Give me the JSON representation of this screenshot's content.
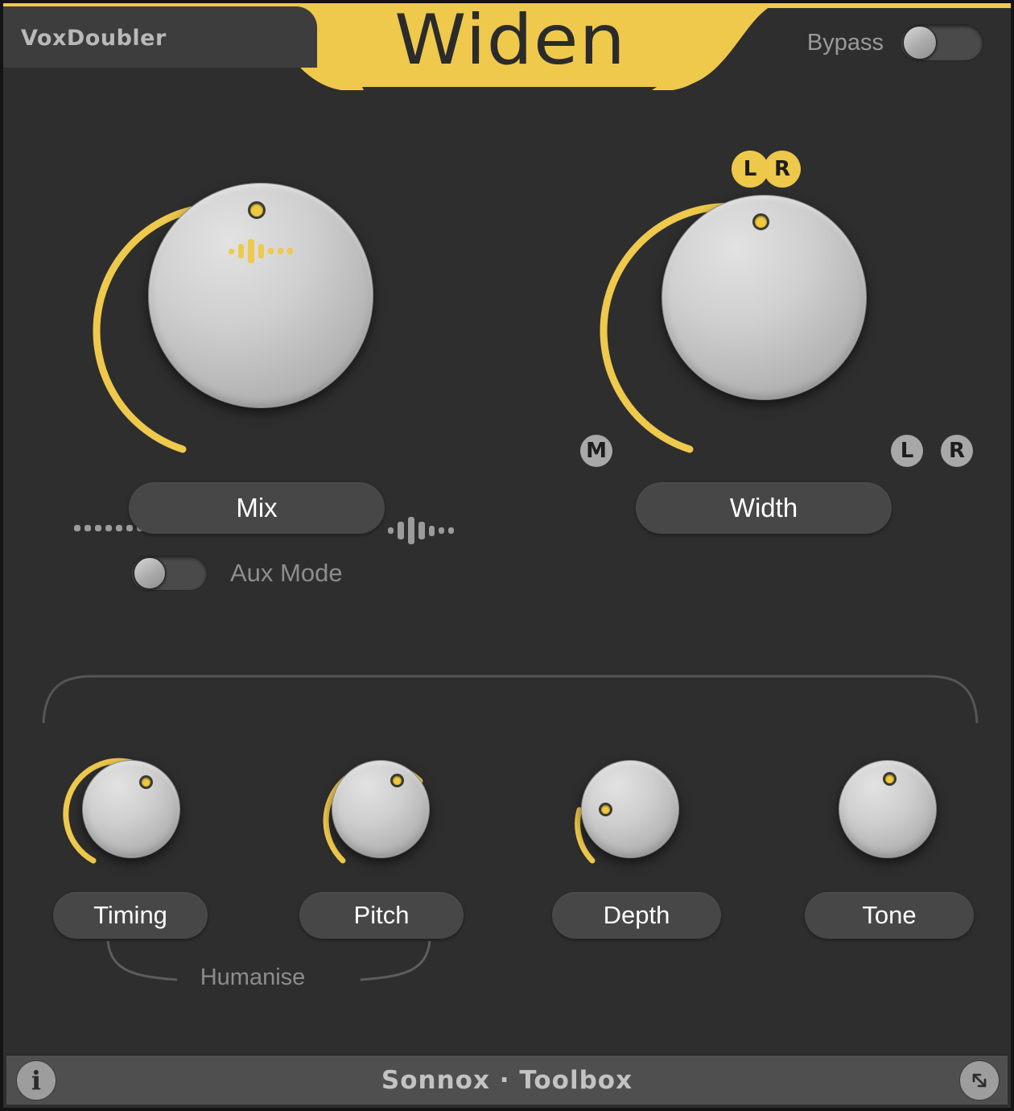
{
  "window": {
    "background_color": "#2e2e2e",
    "accent_color": "#efc94c",
    "knob_color": "#c8c8c8"
  },
  "header": {
    "product_name": "VoxDoubler",
    "module_title": "Widen",
    "bypass_label": "Bypass",
    "bypass_state": "off",
    "banner_color": "#efc94c"
  },
  "main": {
    "knobs": [
      {
        "id": "mix",
        "label": "Mix",
        "value_arc_start_deg": 230,
        "value_arc_end_deg": 360,
        "pointer_angle_deg": 352,
        "min_icon": "dots-icon",
        "max_icon": "waveform-icon",
        "top_icon": "waveform-icon-active"
      },
      {
        "id": "width",
        "label": "Width",
        "value_arc_start_deg": 230,
        "value_arc_end_deg": 360,
        "pointer_angle_deg": 352,
        "top_badge": "LR",
        "top_badge_left": "L",
        "top_badge_right": "R",
        "min_button": "M",
        "max_buttons": [
          "L",
          "R"
        ]
      }
    ],
    "aux_mode": {
      "label": "Aux Mode",
      "state": "off"
    },
    "humanise": {
      "label": "Humanise"
    },
    "small_knobs": [
      {
        "id": "timing",
        "label": "Timing",
        "arc_end_deg": 42,
        "pointer_angle_deg": 38
      },
      {
        "id": "pitch",
        "label": "Pitch",
        "arc_end_deg": 52,
        "pointer_angle_deg": 44
      },
      {
        "id": "depth",
        "label": "Depth",
        "arc_end_deg": -58,
        "pointer_angle_deg": -54
      },
      {
        "id": "tone",
        "label": "Tone",
        "arc_end_deg": -90,
        "pointer_angle_deg": 2
      }
    ]
  },
  "footer": {
    "brand": "Sonnox",
    "separator": "·",
    "suite": "Toolbox",
    "brand_text": "Sonnox · Toolbox",
    "info_glyph": "i",
    "resize_icon": "resize-diagonal-icon"
  }
}
